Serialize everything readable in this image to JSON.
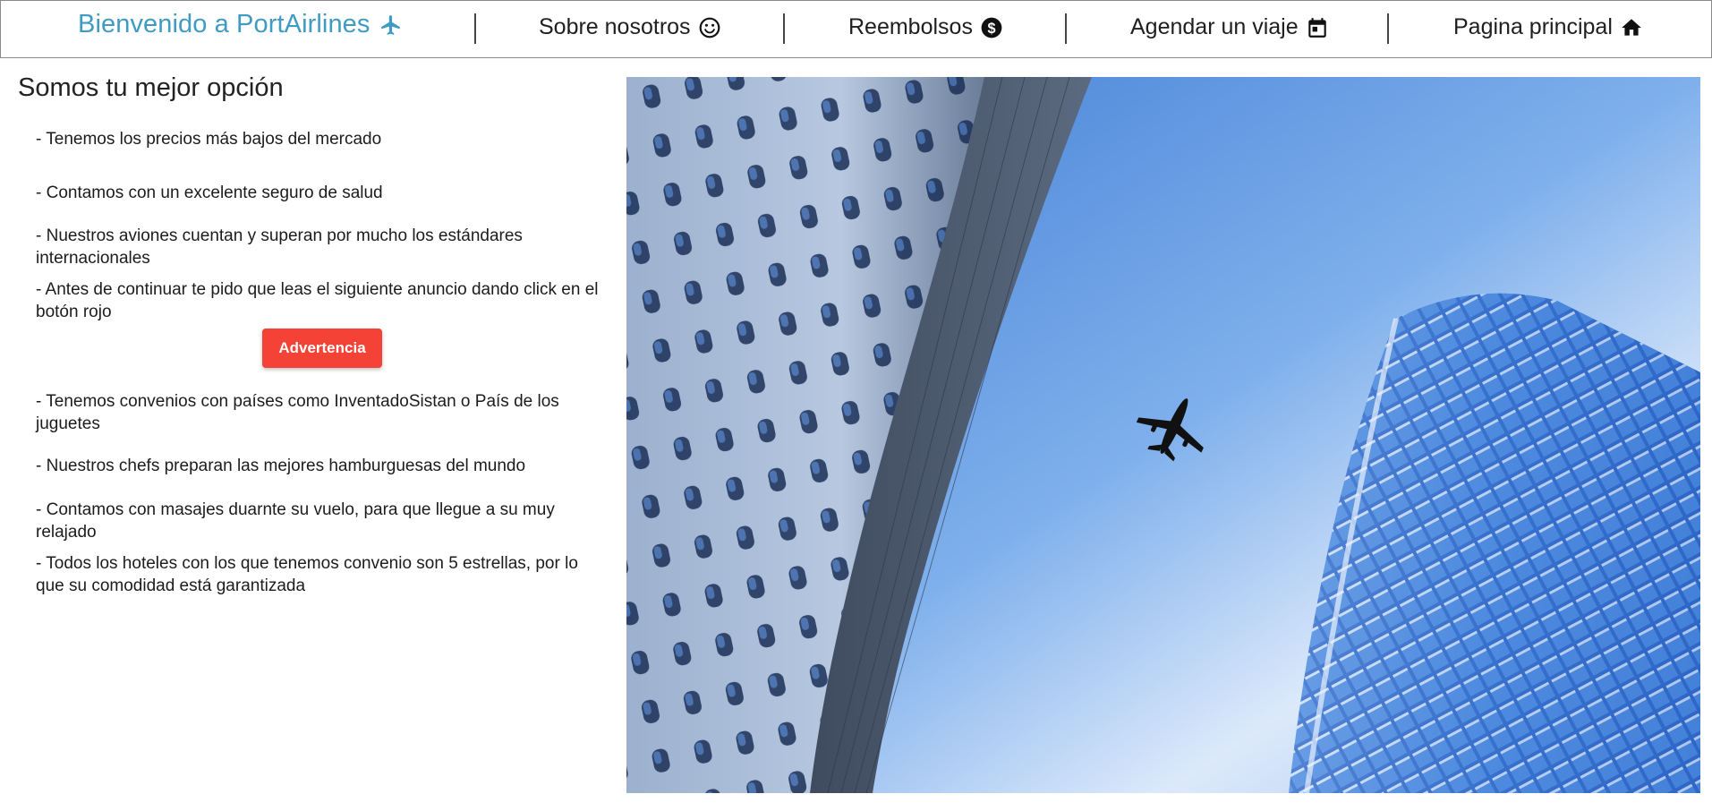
{
  "header": {
    "brand": {
      "label": "Bienvenido a PortAirlines",
      "icon": "airplane-icon",
      "color": "#3f9bc4"
    },
    "nav": [
      {
        "label": "Sobre nosotros",
        "icon": "smiley-icon"
      },
      {
        "label": "Reembolsos",
        "icon": "dollar-coin-icon"
      },
      {
        "label": "Agendar un viaje",
        "icon": "calendar-icon"
      },
      {
        "label": "Pagina principal",
        "icon": "home-icon"
      }
    ]
  },
  "main": {
    "title": "Somos tu mejor opción",
    "features": [
      "- Tenemos los precios más bajos del mercado",
      "- Contamos con un excelente seguro de salud",
      "- Nuestros aviones cuentan y superan por mucho los estándares internacionales",
      "- Antes de continuar te pido que leas el siguiente anuncio dando click en el botón rojo",
      "- Tenemos convenios con países como InventadoSistan o País de los juguetes",
      "- Nuestros chefs preparan las mejores hamburguesas del mundo",
      "- Contamos con masajes duarnte su vuelo, para que llegue a su muy relajado",
      "- Todos los hoteles con los que tenemos convenio son 5 estrellas, por lo que su comodidad está garantizada"
    ],
    "warning_button": {
      "label": "Advertencia",
      "color": "#f44336"
    }
  },
  "hero": {
    "icon": "airplane-photo"
  }
}
